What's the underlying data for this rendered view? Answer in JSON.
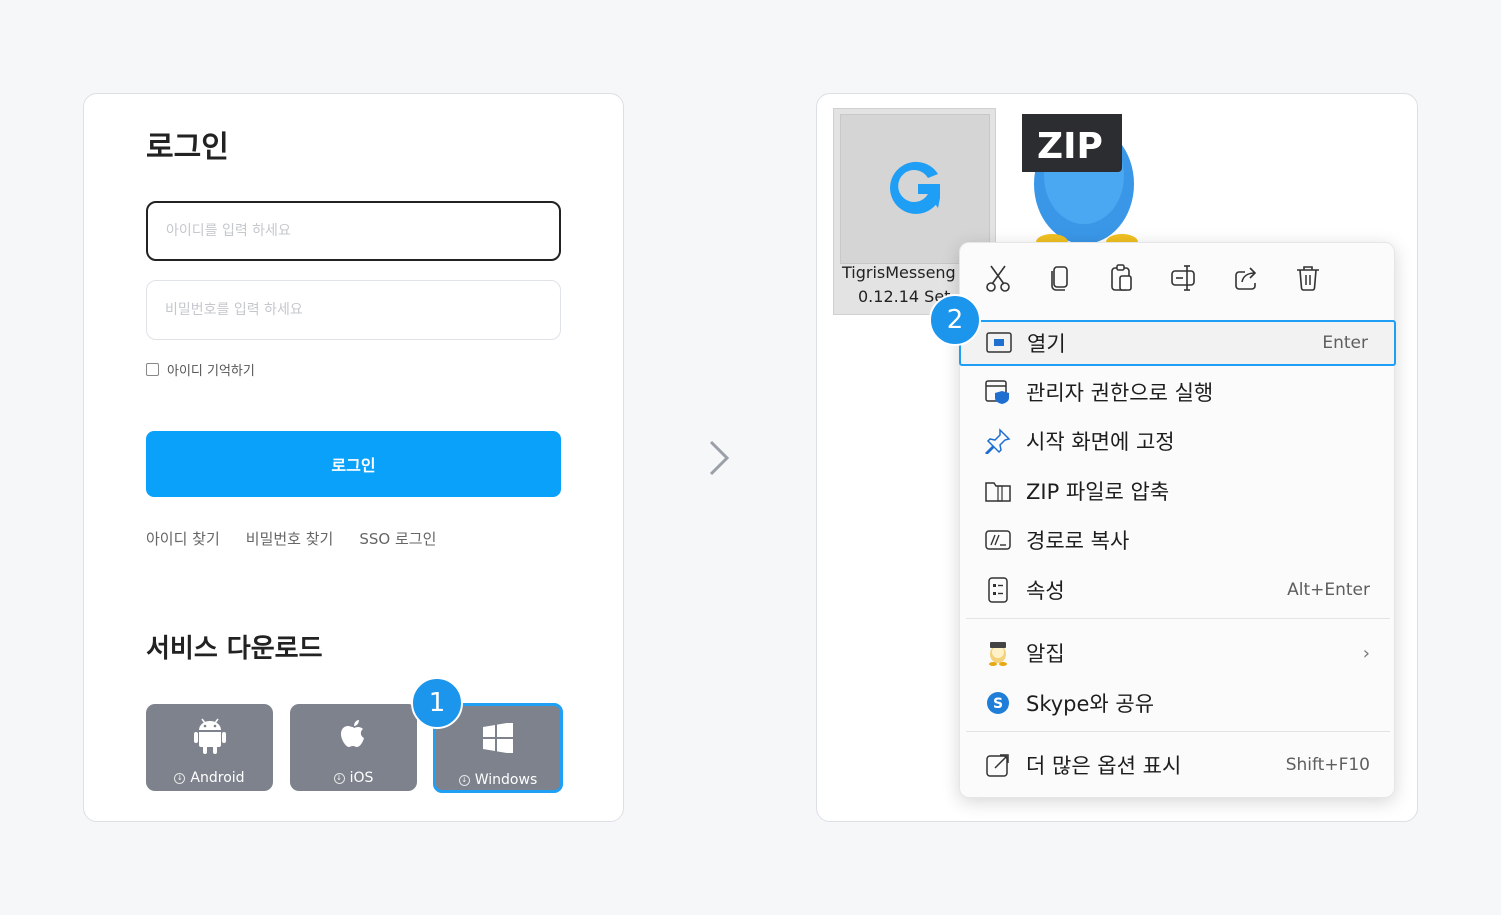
{
  "login": {
    "title": "로그인",
    "id_placeholder": "아이디를 입력 하세요",
    "pw_placeholder": "비밀번호를 입력 하세요",
    "remember_label": "아이디 기억하기",
    "login_button": "로그인",
    "links": [
      "아이디 찾기",
      "비밀번호 찾기",
      "SSO 로그인"
    ]
  },
  "download": {
    "title": "서비스 다운로드",
    "buttons": [
      {
        "label": "Android",
        "icon": "android-icon"
      },
      {
        "label": "iOS",
        "icon": "apple-icon"
      },
      {
        "label": "Windows",
        "icon": "windows-icon"
      }
    ]
  },
  "badges": {
    "step1": "1",
    "step2": "2"
  },
  "explorer": {
    "file_name_line1": "TigrisMesseng",
    "file_name_line2": "0.12.14 Set",
    "zip_label": "ZIP"
  },
  "context_menu": {
    "toolbar": [
      "cut-icon",
      "copy-icon",
      "paste-icon",
      "rename-icon",
      "share-icon",
      "delete-icon"
    ],
    "items": [
      {
        "label": "열기",
        "shortcut": "Enter",
        "icon": "open-icon"
      },
      {
        "label": "관리자 권한으로 실행",
        "shortcut": "",
        "icon": "admin-shield-icon"
      },
      {
        "label": "시작 화면에 고정",
        "shortcut": "",
        "icon": "pin-icon"
      },
      {
        "label": "ZIP 파일로 압축",
        "shortcut": "",
        "icon": "zip-folder-icon"
      },
      {
        "label": "경로로 복사",
        "shortcut": "",
        "icon": "copy-path-icon"
      },
      {
        "label": "속성",
        "shortcut": "Alt+Enter",
        "icon": "properties-icon"
      },
      {
        "label": "알집",
        "shortcut": "",
        "icon": "alzip-icon"
      },
      {
        "label": "Skype와 공유",
        "shortcut": "",
        "icon": "skype-icon"
      },
      {
        "label": "더 많은 옵션 표시",
        "shortcut": "Shift+F10",
        "icon": "more-options-icon"
      }
    ]
  },
  "colors": {
    "accent": "#0aa1fa",
    "download_btn": "#7d828c",
    "badge": "#1b96ec"
  }
}
